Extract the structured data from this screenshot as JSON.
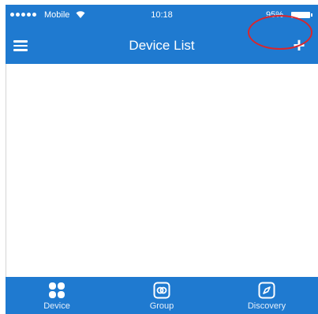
{
  "status_bar": {
    "carrier": "Mobile",
    "time": "10:18",
    "battery": "95%"
  },
  "nav": {
    "title": "Device List",
    "add_label": "+"
  },
  "tabs": [
    {
      "label": "Device",
      "icon": "device-grid-icon"
    },
    {
      "label": "Group",
      "icon": "group-icon"
    },
    {
      "label": "Discovery",
      "icon": "compass-icon"
    }
  ],
  "colors": {
    "primary": "#1f7ad0",
    "highlight": "#d9262c",
    "background": "#ffffff"
  }
}
